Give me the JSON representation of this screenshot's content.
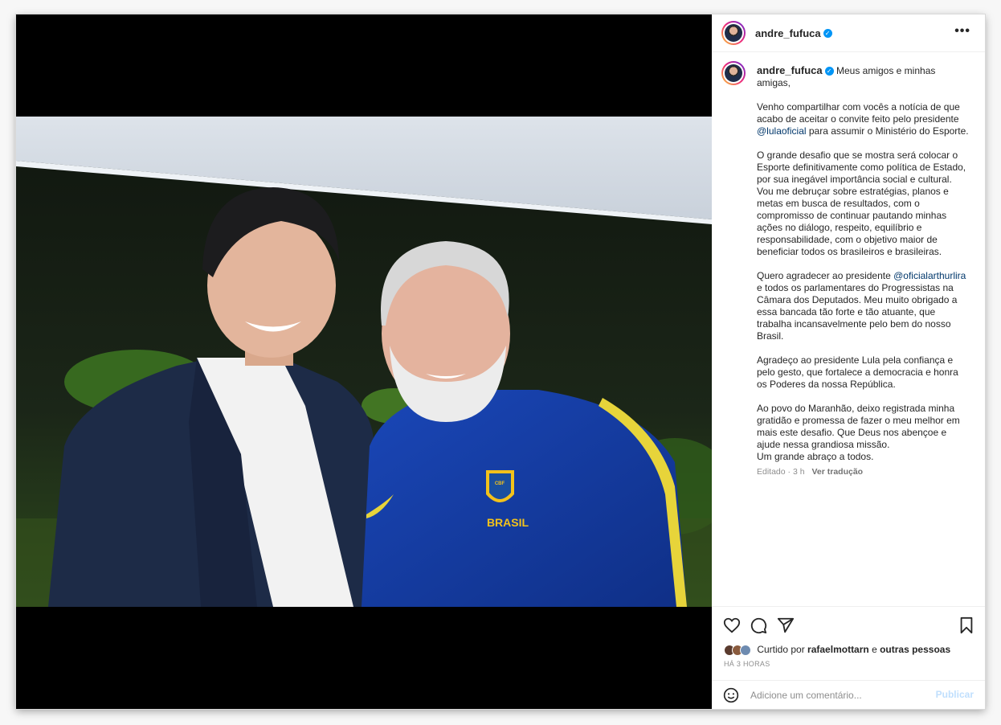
{
  "post": {
    "username": "andre_fufuca",
    "verified_icon": "verified-badge-icon",
    "more_icon": "more-options-icon"
  },
  "caption": {
    "username": "andre_fufuca",
    "greeting": " Meus amigos e minhas amigas,",
    "p1_a": "Venho compartilhar com vocês a notícia de que acabo de aceitar o convite feito pelo presidente ",
    "p1_mention": "@lulaoficial",
    "p1_b": " para assumir o Ministério do Esporte.",
    "p2": "O grande desafio que se mostra será colocar o Esporte definitivamente como política de Estado, por sua inegável importância social e cultural. Vou me debruçar sobre estratégias, planos e metas em busca de resultados, com o compromisso de continuar pautando minhas ações no diálogo, respeito, equilíbrio e responsabilidade, com o objetivo maior de beneficiar todos os brasileiros e brasileiras.",
    "p3_a": "Quero agradecer ao presidente ",
    "p3_mention": "@oficialarthurlira",
    "p3_b": " e todos os parlamentares do Progressistas na Câmara dos Deputados. Meu muito obrigado a essa bancada tão forte e tão atuante, que trabalha incansavelmente pelo bem do nosso Brasil.",
    "p4": "Agradeço ao presidente Lula pela confiança e pelo gesto, que fortalece a democracia e honra os Poderes da nossa República.",
    "p5_a": "Ao povo do Maranhão, deixo registrada minha gratidão e promessa de fazer o meu melhor em mais este desafio. Que Deus nos abençoe e ajude nessa grandiosa missão.",
    "p5_b": "Um grande abraço a todos.",
    "edited": "Editado · 3 h",
    "translate": "Ver tradução"
  },
  "actions": {
    "like_icon": "heart-icon",
    "comment_icon": "comment-icon",
    "share_icon": "share-icon",
    "save_icon": "bookmark-icon",
    "liked_prefix": "Curtido por ",
    "liked_user": "rafaelmottarn",
    "liked_mid": " e ",
    "liked_others": "outras pessoas",
    "time": "HÁ 3 HORAS"
  },
  "comment": {
    "emoji_icon": "emoji-icon",
    "placeholder": "Adicione um comentário...",
    "post_label": "Publicar"
  },
  "photo": {
    "jersey_text": "BRASIL",
    "badge_text": "CBF"
  },
  "colors": {
    "link": "#00376b",
    "verified": "#0095f6",
    "post_button_disabled": "#c0dffd"
  }
}
